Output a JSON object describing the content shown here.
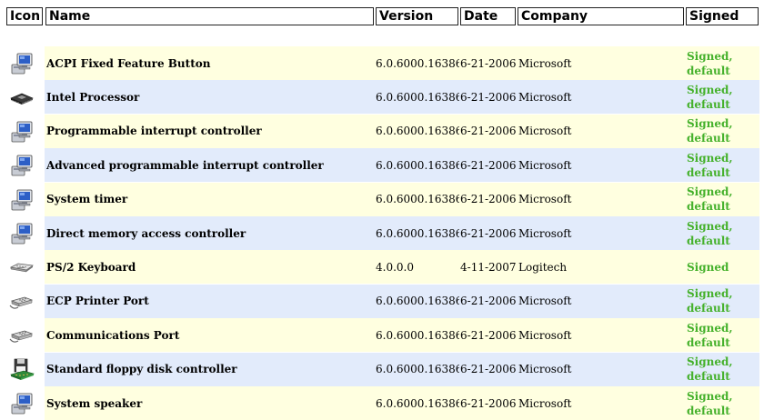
{
  "headers": {
    "icon": "Icon",
    "name": "Name",
    "version": "Version",
    "date": "Date",
    "company": "Company",
    "signed": "Signed"
  },
  "rows": [
    {
      "icon": "computer-icon",
      "name": "ACPI Fixed Feature Button",
      "version": "6.0.6000.16386",
      "date": "6-21-2006",
      "company": "Microsoft",
      "signed": "Signed, default"
    },
    {
      "icon": "processor-chip-icon",
      "name": "Intel Processor",
      "version": "6.0.6000.16386",
      "date": "6-21-2006",
      "company": "Microsoft",
      "signed": "Signed, default"
    },
    {
      "icon": "computer-icon",
      "name": "Programmable interrupt controller",
      "version": "6.0.6000.16386",
      "date": "6-21-2006",
      "company": "Microsoft",
      "signed": "Signed, default"
    },
    {
      "icon": "computer-icon",
      "name": "Advanced programmable interrupt controller",
      "version": "6.0.6000.16386",
      "date": "6-21-2006",
      "company": "Microsoft",
      "signed": "Signed, default"
    },
    {
      "icon": "computer-icon",
      "name": "System timer",
      "version": "6.0.6000.16386",
      "date": "6-21-2006",
      "company": "Microsoft",
      "signed": "Signed, default"
    },
    {
      "icon": "computer-icon",
      "name": "Direct memory access controller",
      "version": "6.0.6000.16386",
      "date": "6-21-2006",
      "company": "Microsoft",
      "signed": "Signed, default"
    },
    {
      "icon": "keyboard-icon",
      "name": "PS/2 Keyboard",
      "version": "4.0.0.0",
      "date": "4-11-2007",
      "company": "Logitech",
      "signed": "Signed"
    },
    {
      "icon": "port-connector-icon",
      "name": "ECP Printer Port",
      "version": "6.0.6000.16386",
      "date": "6-21-2006",
      "company": "Microsoft",
      "signed": "Signed, default"
    },
    {
      "icon": "port-connector-icon",
      "name": "Communications Port",
      "version": "6.0.6000.16386",
      "date": "6-21-2006",
      "company": "Microsoft",
      "signed": "Signed, default"
    },
    {
      "icon": "floppy-controller-icon",
      "name": "Standard floppy disk controller",
      "version": "6.0.6000.16386",
      "date": "6-21-2006",
      "company": "Microsoft",
      "signed": "Signed, default"
    },
    {
      "icon": "computer-icon",
      "name": "System speaker",
      "version": "6.0.6000.16386",
      "date": "6-21-2006",
      "company": "Microsoft",
      "signed": "Signed, default"
    }
  ],
  "colors": {
    "row_even": "#ffffe0",
    "row_odd": "#e2ebfb",
    "signed_text": "#45b12b"
  }
}
